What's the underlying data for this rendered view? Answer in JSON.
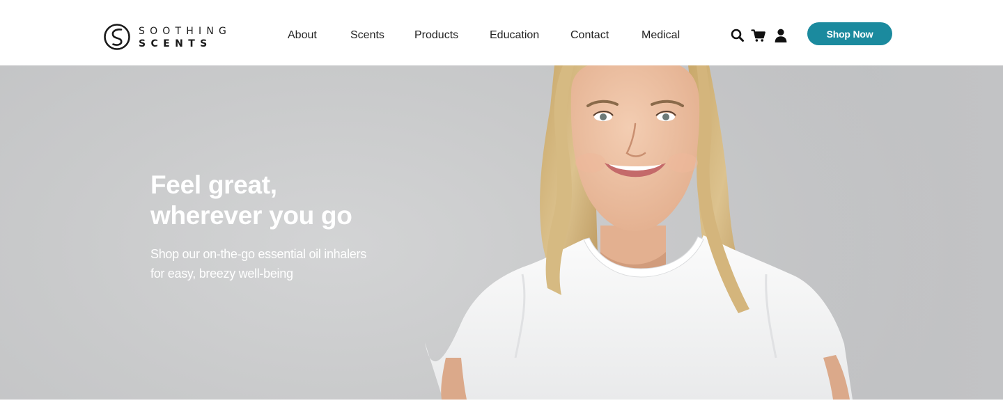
{
  "brand": {
    "line1": "SOOTHING",
    "line2": "SCENTS"
  },
  "nav": {
    "items": [
      "About",
      "Scents",
      "Products",
      "Education",
      "Contact",
      "Medical"
    ]
  },
  "icons": {
    "search": "search-icon",
    "cart": "cart-icon",
    "account": "user-icon"
  },
  "cta": {
    "label": "Shop Now"
  },
  "hero": {
    "title_line1": "Feel great,",
    "title_line2": "wherever you go",
    "subtitle_line1": "Shop our on-the-go essential oil inhalers",
    "subtitle_line2": "for easy, breezy well-being"
  },
  "colors": {
    "accent": "#1b8a9e",
    "hero_background": "#c9cacb",
    "text_dark": "#222222",
    "text_light": "#ffffff"
  }
}
